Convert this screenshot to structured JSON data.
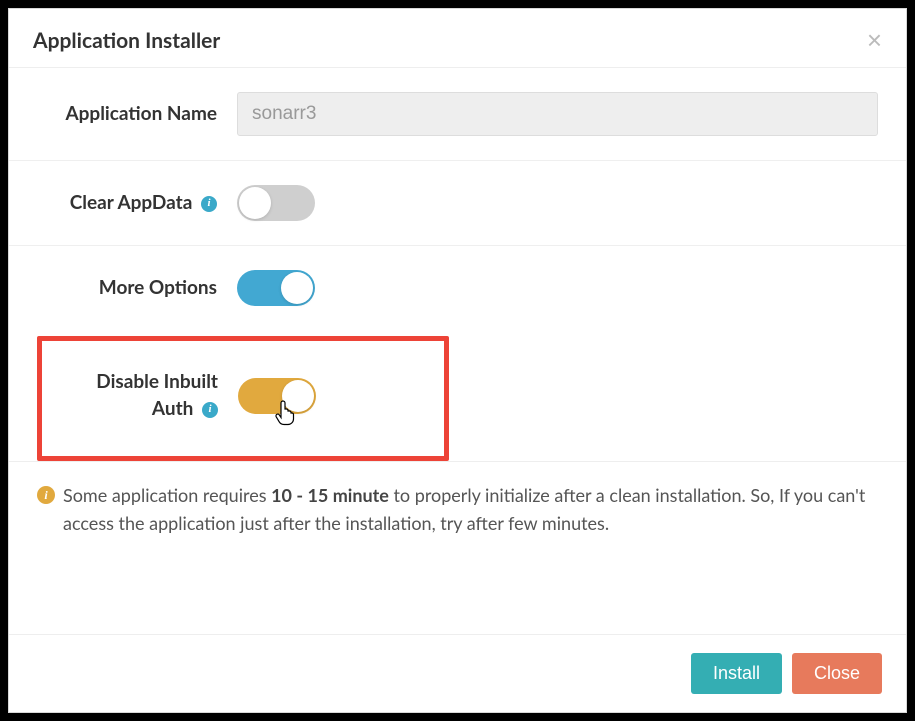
{
  "header": {
    "title": "Application Installer",
    "close_aria": "Close"
  },
  "form": {
    "app_name": {
      "label": "Application Name",
      "value": "sonarr3"
    },
    "clear_appdata": {
      "label": "Clear AppData",
      "on": false
    },
    "more_options": {
      "label": "More Options",
      "on": true
    },
    "disable_auth": {
      "label_line1": "Disable Inbuilt",
      "label_line2": "Auth",
      "on": true
    }
  },
  "note": {
    "pre": "Some application requires ",
    "bold": "10 - 15 minute",
    "post": " to properly initialize after a clean installation. So, If you can't access the application just after the installation, try after few minutes."
  },
  "footer": {
    "install": "Install",
    "close": "Close"
  }
}
